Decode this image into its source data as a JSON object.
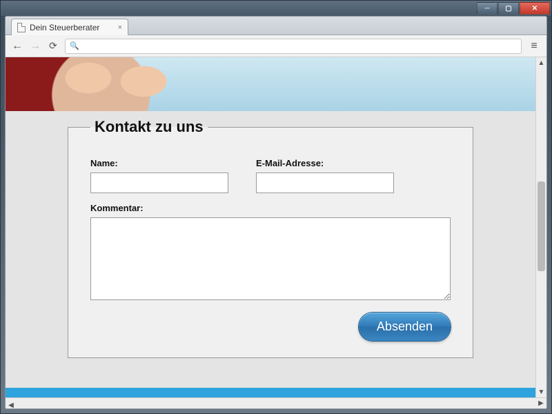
{
  "browser": {
    "tab_title": "Dein Steuerberater",
    "address": ""
  },
  "form": {
    "legend": "Kontakt zu uns",
    "name": {
      "label": "Name:",
      "value": ""
    },
    "email": {
      "label": "E-Mail-Adresse:",
      "value": ""
    },
    "comment": {
      "label": "Kommentar:",
      "value": ""
    },
    "submit_label": "Absenden"
  }
}
